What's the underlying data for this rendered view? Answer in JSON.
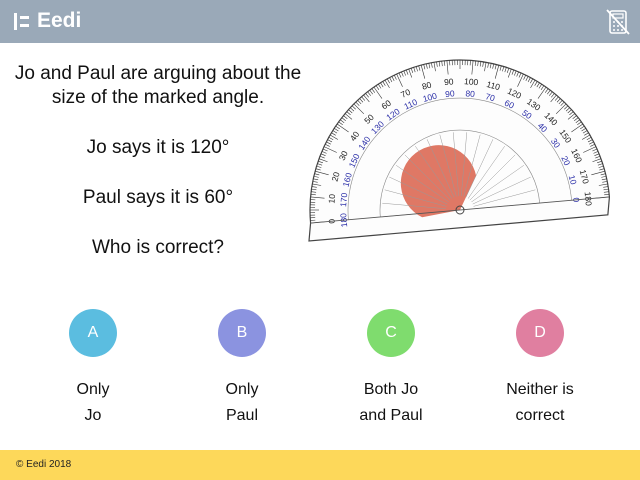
{
  "header": {
    "brand": "Eedi",
    "background": "#9aa9b8",
    "icon": "calculator-crossed-icon"
  },
  "question": {
    "intro": "Jo and Paul are arguing about the size of the marked angle.",
    "jo_claim": "Jo says it is 120°",
    "paul_claim": "Paul says it is 60°",
    "ask": "Who is correct?"
  },
  "protractor": {
    "outer_scale_labels": [
      "0",
      "10",
      "20",
      "30",
      "40",
      "50",
      "60",
      "70",
      "80",
      "90",
      "100",
      "110",
      "120",
      "130",
      "140",
      "150",
      "160",
      "170",
      "180"
    ],
    "inner_scale_labels": [
      "180",
      "170",
      "160",
      "150",
      "140",
      "130",
      "120",
      "110",
      "100",
      "90",
      "80",
      "70",
      "60",
      "50",
      "40",
      "30",
      "20",
      "10",
      "0"
    ],
    "outer_color": "#222222",
    "inner_color": "#2b2fa8",
    "marked_angle_color": "#d9604a",
    "marked_angle_deg": 120
  },
  "options": [
    {
      "letter": "A",
      "line1": "Only",
      "line2": "Jo",
      "color": "#5bbde0"
    },
    {
      "letter": "B",
      "line1": "Only",
      "line2": "Paul",
      "color": "#8b93e0"
    },
    {
      "letter": "C",
      "line1": "Both Jo",
      "line2": "and Paul",
      "color": "#7fdc6e"
    },
    {
      "letter": "D",
      "line1": "Neither is",
      "line2": "correct",
      "color": "#e07fa0"
    }
  ],
  "footer": {
    "copyright": "© Eedi 2018",
    "background": "#fdd85a"
  }
}
